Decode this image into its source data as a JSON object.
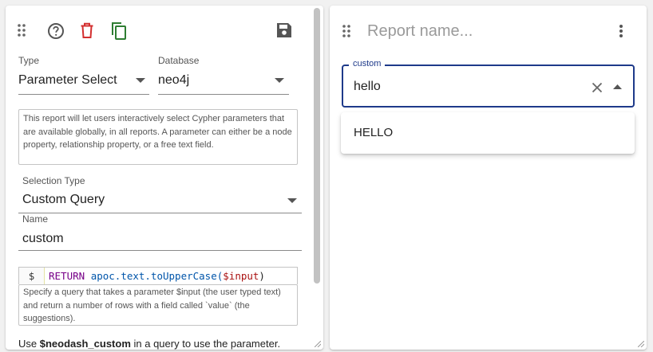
{
  "left_card": {
    "toolbar": {
      "drag_icon": "drag-handle-icon",
      "help_icon": "help-circle-icon",
      "delete_icon": "trash-icon",
      "copy_icon": "copy-icon",
      "save_icon": "floppy-disk-icon",
      "delete_color": "#d32f2f",
      "copy_color": "#2e7d32"
    },
    "type_field": {
      "label": "Type",
      "value": "Parameter Select"
    },
    "database_field": {
      "label": "Database",
      "value": "neo4j"
    },
    "description": "This report will let users interactively select Cypher parameters that are available globally, in all reports. A parameter can either be a node property, relationship property, or a free text field.",
    "selection_type": {
      "label": "Selection Type",
      "value": "Custom Query"
    },
    "name_field": {
      "label": "Name",
      "value": "custom"
    },
    "code": {
      "gutter": "$",
      "keyword": "RETURN",
      "function": "apoc.text.toUpperCase(",
      "variable": "$input",
      "close": ")"
    },
    "code_help": "Specify a query that takes a parameter $input (the user typed text) and return a number of rows with a field called `value` (the suggestions).",
    "footer_text": {
      "prefix": "Use ",
      "param": "$neodash_custom",
      "suffix": " in a query to use the parameter."
    }
  },
  "right_card": {
    "title_placeholder": "Report name...",
    "menu_icon": "more-vertical-icon",
    "autocomplete": {
      "label": "custom",
      "value": "hello",
      "clear_icon": "close-icon",
      "open_icon": "arrow-up-icon",
      "accent_color": "#1e3a8a"
    },
    "options": [
      "HELLO"
    ]
  }
}
